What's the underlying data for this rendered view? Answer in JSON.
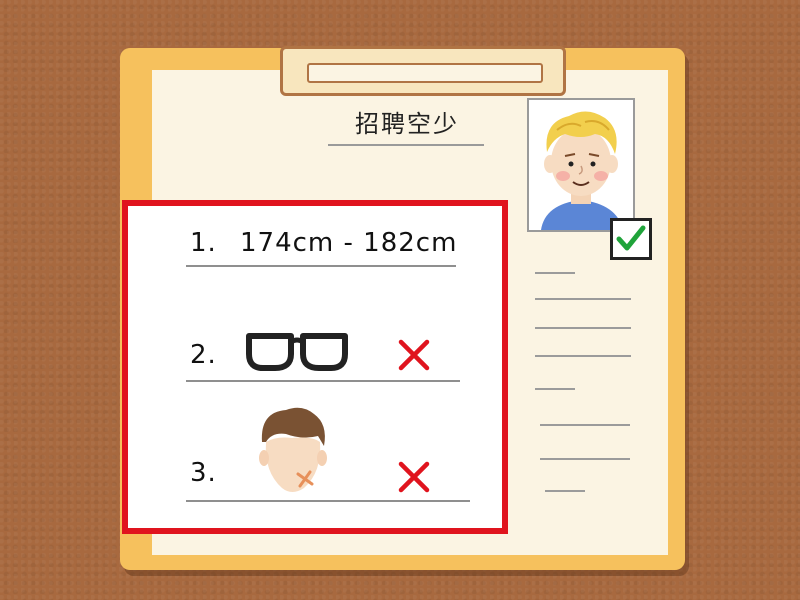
{
  "document": {
    "title": "招聘空少"
  },
  "requirements": [
    {
      "number": "1.",
      "text": "174cm - 182cm"
    },
    {
      "number": "2.",
      "icon": "glasses-icon",
      "mark": "cross-icon"
    },
    {
      "number": "3.",
      "icon": "scarred-face-icon",
      "mark": "cross-icon"
    }
  ],
  "candidate": {
    "photo": "smiling-blond-man-portrait",
    "status_icon": "checkmark-icon"
  },
  "colors": {
    "highlight_border": "#e0141e",
    "cross": "#e0141e",
    "check": "#1fa33a",
    "clipboard": "#f6c15d",
    "background": "#a8693f"
  }
}
